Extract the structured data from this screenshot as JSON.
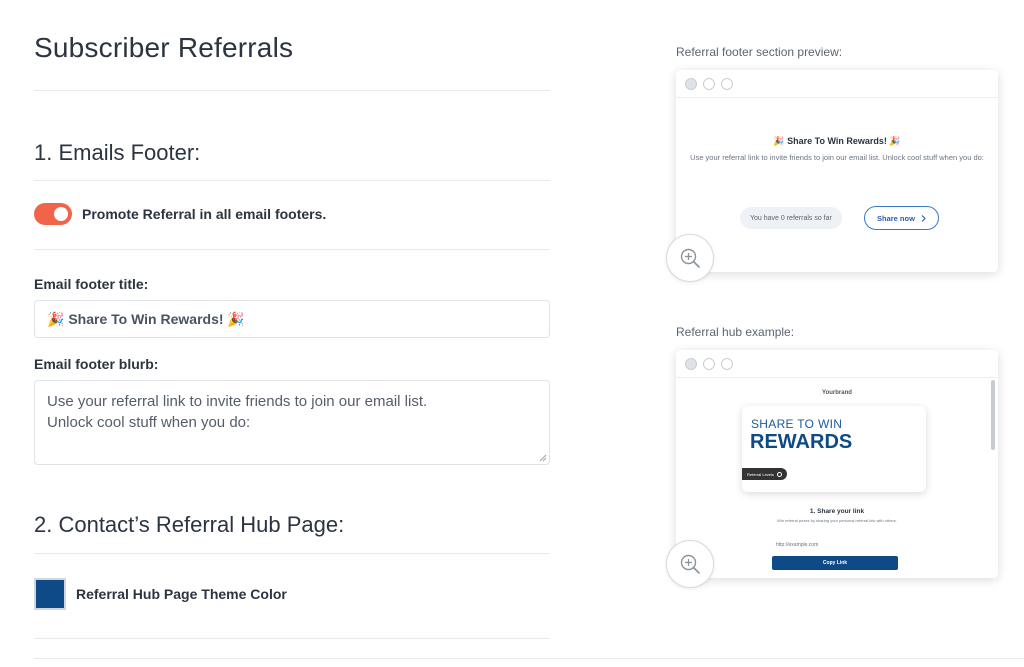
{
  "page": {
    "title": "Subscriber Referrals"
  },
  "emails_footer": {
    "section_title": "1. Emails Footer:",
    "toggle_label": "Promote Referral in all email footers.",
    "toggle_on": true,
    "title_label": "Email footer title:",
    "title_value": "🎉 Share To Win Rewards! 🎉",
    "blurb_label": "Email footer blurb:",
    "blurb_value": "Use your referral link to invite friends to join our email list.\nUnlock cool stuff when you do:"
  },
  "hub_page": {
    "section_title": "2. Contact’s Referral Hub Page:",
    "theme_color_label": "Referral Hub Page Theme Color",
    "theme_color": "#0e4a86"
  },
  "footer_preview": {
    "caption": "Referral footer section preview:",
    "title": "🎉 Share To Win Rewards! 🎉",
    "blurb": "Use your referral link to invite friends to join our email list. Unlock cool stuff when you do:",
    "referrals_text": "You have 0 referrals so far",
    "share_button": "Share now",
    "zoom_icon": "zoom-in-icon"
  },
  "hub_example": {
    "caption": "Referral hub example:",
    "logo": "Yourbrand",
    "hero_line1": "SHARE TO WIN",
    "hero_line2": "REWARDS",
    "badge": "Referral Levels",
    "step_title": "1. Share your link",
    "step_desc": "Win referral prizes by sharing your personal referral link with others.",
    "url": "http://example.com",
    "copy_button": "Copy Link",
    "zoom_icon": "zoom-in-icon"
  },
  "colors": {
    "accent_toggle": "#f0654a",
    "theme": "#0e4a86"
  }
}
